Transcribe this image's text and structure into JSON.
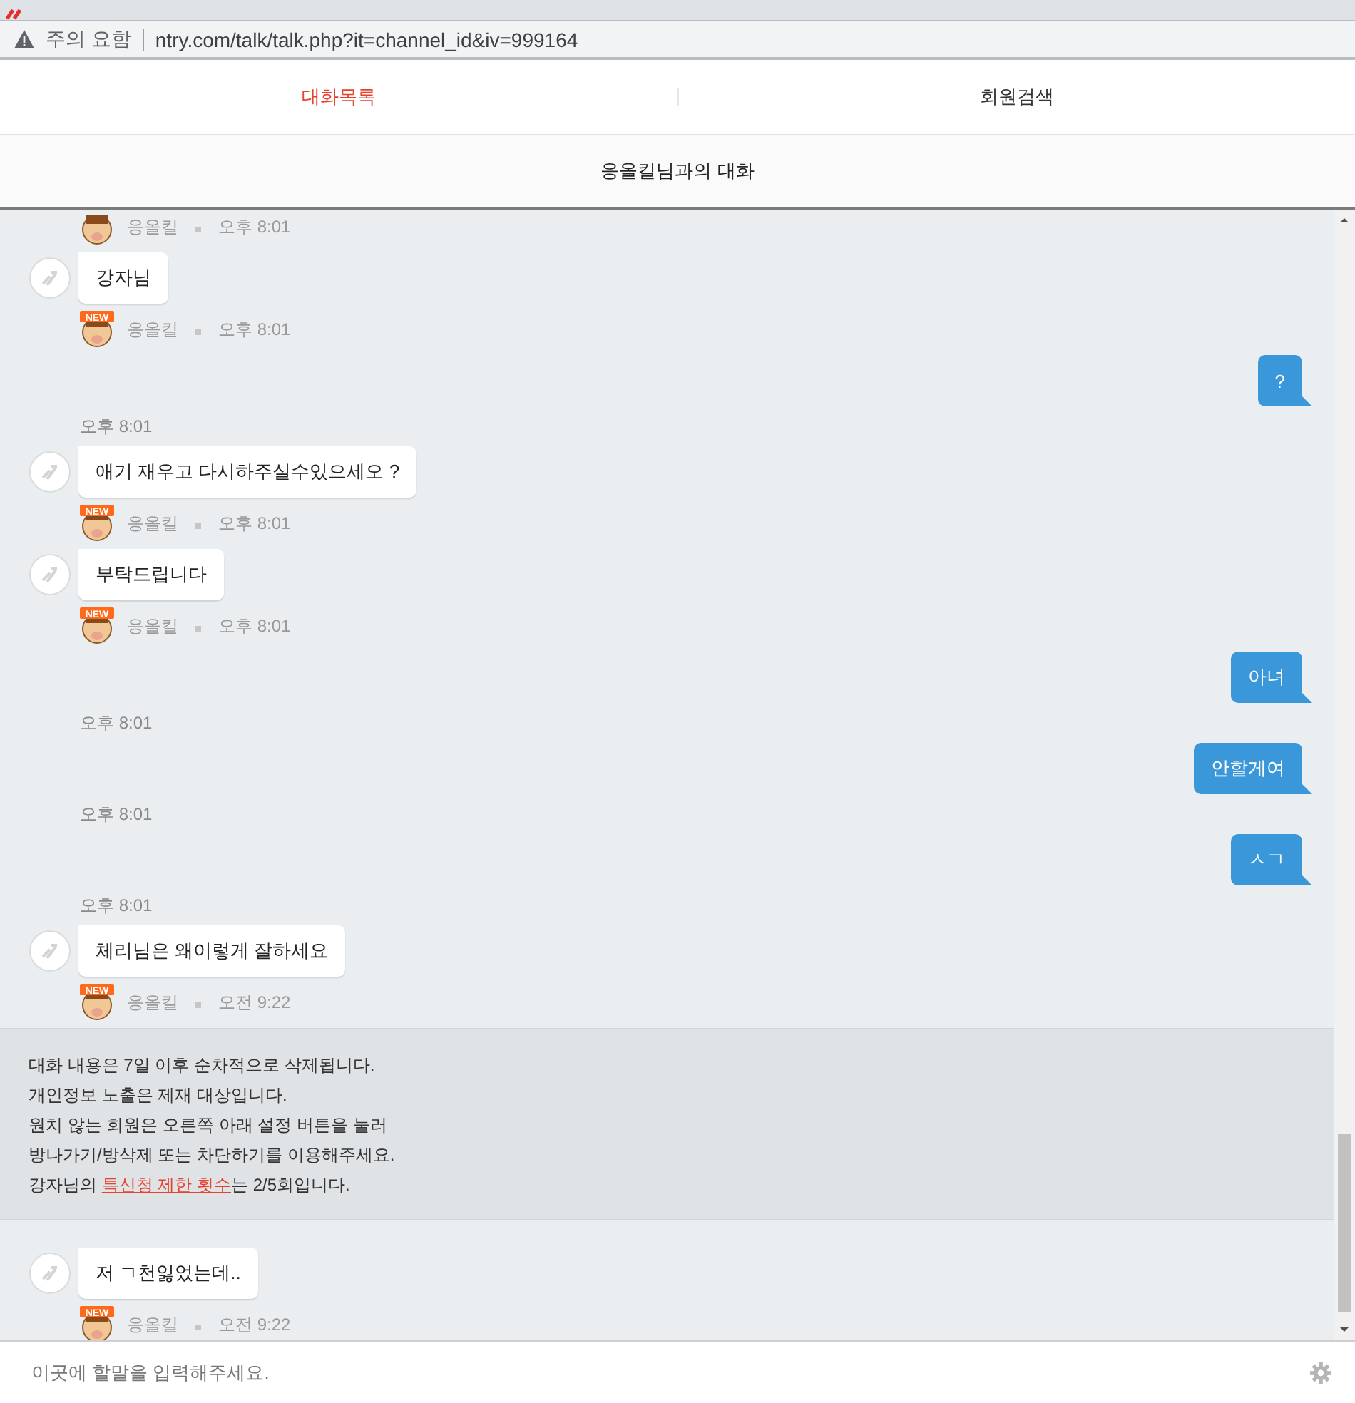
{
  "address_bar": {
    "security": "주의 요함",
    "url": "ntry.com/talk/talk.php?it=channel_id&iv=999164"
  },
  "tabs": [
    {
      "label": "대화목록",
      "selected": true
    },
    {
      "label": "회원검색",
      "selected": false
    }
  ],
  "header": {
    "title": "응올킬님과의 대화"
  },
  "messages": [
    {
      "kind": "meta",
      "name": "응올킬",
      "time": "오후 8:01"
    },
    {
      "kind": "incoming",
      "text": "강자님"
    },
    {
      "kind": "meta",
      "badge": "NEW",
      "name": "응올킬",
      "time": "오후 8:01"
    },
    {
      "kind": "outgoing",
      "text": "?"
    },
    {
      "kind": "time",
      "time": "오후 8:01"
    },
    {
      "kind": "incoming",
      "text": "애기 재우고 다시하주실수있으세오 ?"
    },
    {
      "kind": "meta",
      "badge": "NEW",
      "name": "응올킬",
      "time": "오후 8:01"
    },
    {
      "kind": "incoming",
      "text": "부탁드립니다"
    },
    {
      "kind": "meta",
      "badge": "NEW",
      "name": "응올킬",
      "time": "오후 8:01"
    },
    {
      "kind": "outgoing",
      "text": "아녀"
    },
    {
      "kind": "time",
      "time": "오후 8:01"
    },
    {
      "kind": "outgoing",
      "text": "안할게여"
    },
    {
      "kind": "time",
      "time": "오후 8:01"
    },
    {
      "kind": "outgoing",
      "text": "ㅅㄱ"
    },
    {
      "kind": "time",
      "time": "오후 8:01"
    },
    {
      "kind": "incoming",
      "text": "체리님은 왜이렇게 잘하세요"
    },
    {
      "kind": "meta",
      "badge": "NEW",
      "name": "응올킬",
      "time": "오전 9:22"
    },
    {
      "kind": "notice",
      "lines": [
        "대화 내용은 7일 이후 순차적으로 삭제됩니다.",
        "개인정보 노출은 제재 대상입니다.",
        "원치 않는 회원은 오른쪽 아래 설정 버튼을 눌러",
        "방나가기/방삭제 또는 차단하기를 이용해주세요."
      ],
      "last_line": {
        "before": "강자님의 ",
        "link": "특신청 제한 횟수",
        "after": "는 2/5회입니다."
      }
    },
    {
      "kind": "incoming",
      "text": "저 ㄱ천잃었는데.."
    },
    {
      "kind": "meta",
      "badge": "NEW",
      "name": "응올킬",
      "time": "오전 9:22"
    }
  ],
  "input": {
    "placeholder": "이곳에 할말을 입력해주세요."
  }
}
